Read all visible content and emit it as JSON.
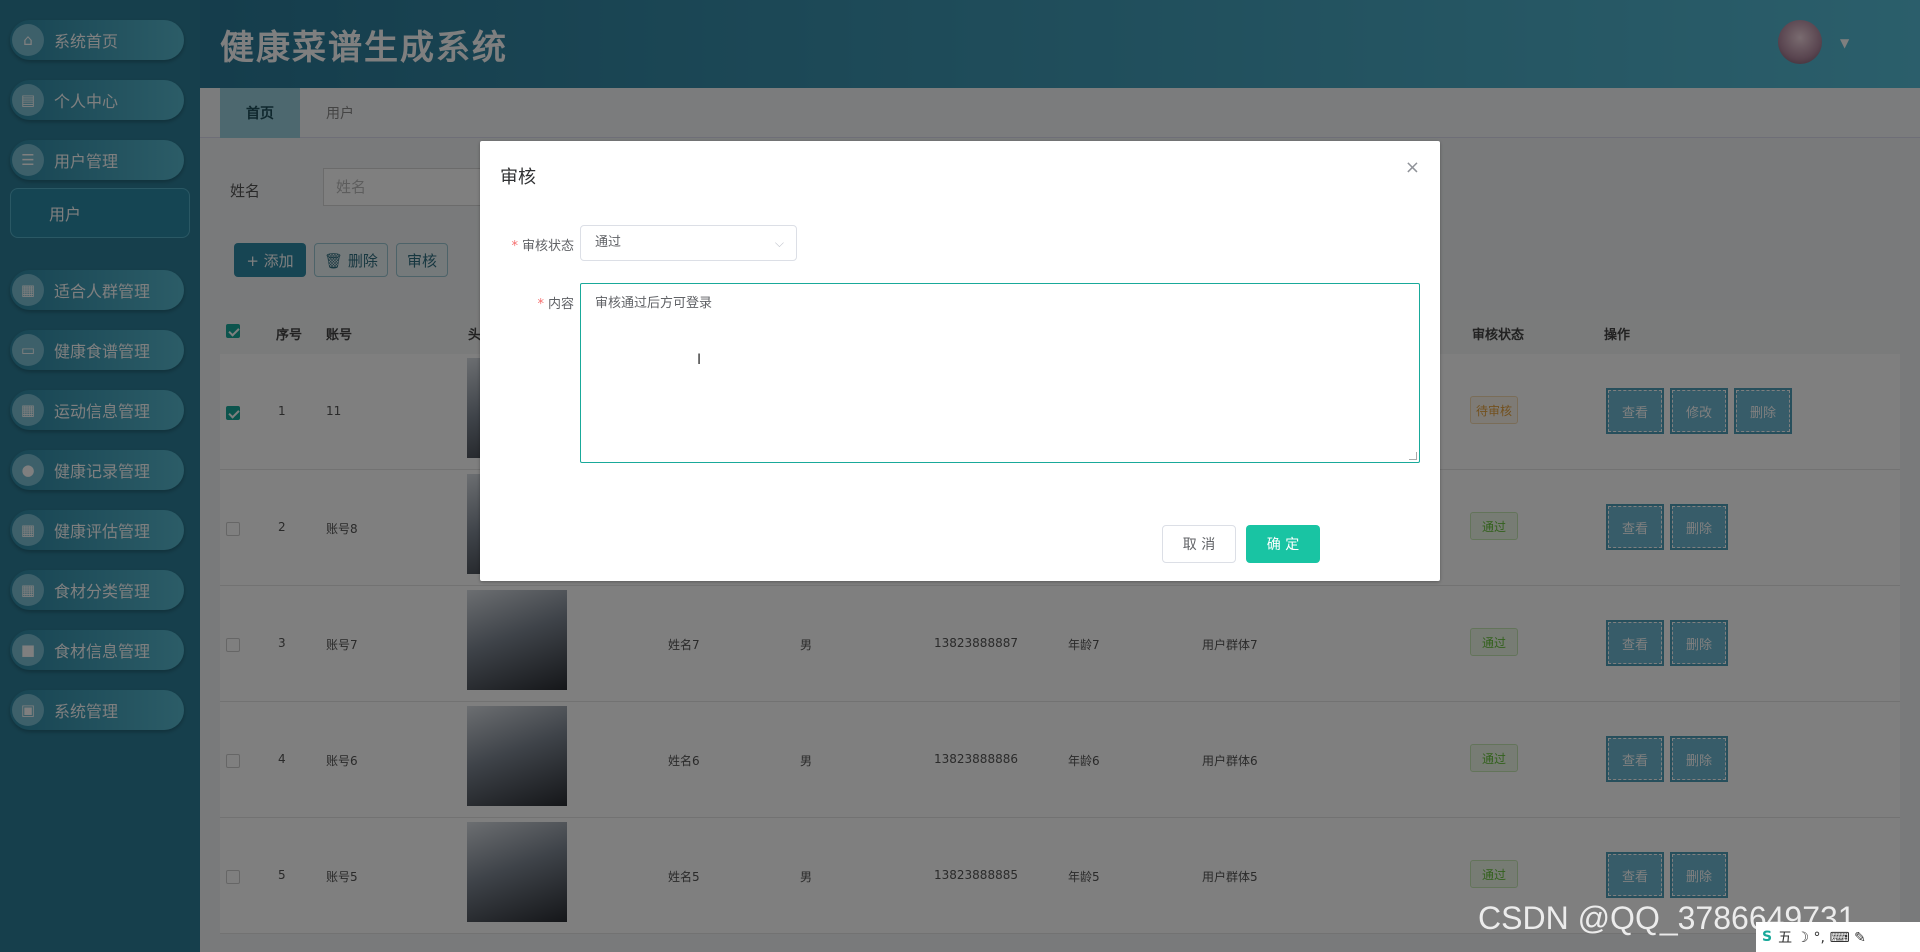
{
  "app": {
    "title": "健康菜谱生成系统"
  },
  "sidebar": {
    "items": [
      {
        "label": "系统首页",
        "icon": "home-icon",
        "glyph": "⌂"
      },
      {
        "label": "个人中心",
        "icon": "profile-icon",
        "glyph": "▤"
      },
      {
        "label": "用户管理",
        "icon": "list-icon",
        "glyph": "☰"
      },
      {
        "label": "适合人群管理",
        "icon": "grid-icon",
        "glyph": "▦"
      },
      {
        "label": "健康食谱管理",
        "icon": "message-icon",
        "glyph": "▭"
      },
      {
        "label": "运动信息管理",
        "icon": "grid-icon",
        "glyph": "▦"
      },
      {
        "label": "健康记录管理",
        "icon": "user-icon",
        "glyph": "●"
      },
      {
        "label": "健康评估管理",
        "icon": "grid-icon",
        "glyph": "▦"
      },
      {
        "label": "食材分类管理",
        "icon": "grid-icon",
        "glyph": "▦"
      },
      {
        "label": "食材信息管理",
        "icon": "briefcase-icon",
        "glyph": "■"
      },
      {
        "label": "系统管理",
        "icon": "chart-icon",
        "glyph": "▣"
      }
    ],
    "sub_item": "用户"
  },
  "tabs": [
    {
      "label": "首页"
    },
    {
      "label": "用户"
    }
  ],
  "search": {
    "label": "姓名",
    "placeholder": "姓名"
  },
  "toolbar": {
    "add": "+ 添加",
    "delete": "🗑 删除",
    "audit": "审核"
  },
  "table": {
    "headers": {
      "index": "序号",
      "account": "账号",
      "avatar": "头",
      "status": "审核状态",
      "ops": "操作"
    },
    "rows": [
      {
        "index": "1",
        "account": "11",
        "name": "",
        "gender": "",
        "phone": "",
        "age": "",
        "group": "",
        "status": "待审核",
        "ops": [
          "查看",
          "修改",
          "删除"
        ],
        "checked": true
      },
      {
        "index": "2",
        "account": "账号8",
        "name": "",
        "gender": "",
        "phone": "",
        "age": "",
        "group": "",
        "status": "通过",
        "ops": [
          "查看",
          "删除"
        ],
        "checked": false
      },
      {
        "index": "3",
        "account": "账号7",
        "name": "姓名7",
        "gender": "男",
        "phone": "13823888887",
        "age": "年龄7",
        "group": "用户群体7",
        "status": "通过",
        "ops": [
          "查看",
          "删除"
        ],
        "checked": false
      },
      {
        "index": "4",
        "account": "账号6",
        "name": "姓名6",
        "gender": "男",
        "phone": "13823888886",
        "age": "年龄6",
        "group": "用户群体6",
        "status": "通过",
        "ops": [
          "查看",
          "删除"
        ],
        "checked": false
      },
      {
        "index": "5",
        "account": "账号5",
        "name": "姓名5",
        "gender": "男",
        "phone": "13823888885",
        "age": "年龄5",
        "group": "用户群体5",
        "status": "通过",
        "ops": [
          "查看",
          "删除"
        ],
        "checked": false
      }
    ]
  },
  "dialog": {
    "title": "审核",
    "close_icon": "×",
    "status_label": "审核状态",
    "status_value": "通过",
    "content_label": "内容",
    "content_value": "审核通过后方可登录",
    "cancel": "取 消",
    "ok": "确 定",
    "required_mark": "*",
    "chevron": "⌵"
  },
  "watermark": "CSDN @QQ_3786649731",
  "tray": {
    "text": "五 ☽ °, ⌨ ✎"
  },
  "colors": {
    "primary": "#19c4a3",
    "sidebar": "#2d7f99",
    "header": "#2a7a98"
  }
}
